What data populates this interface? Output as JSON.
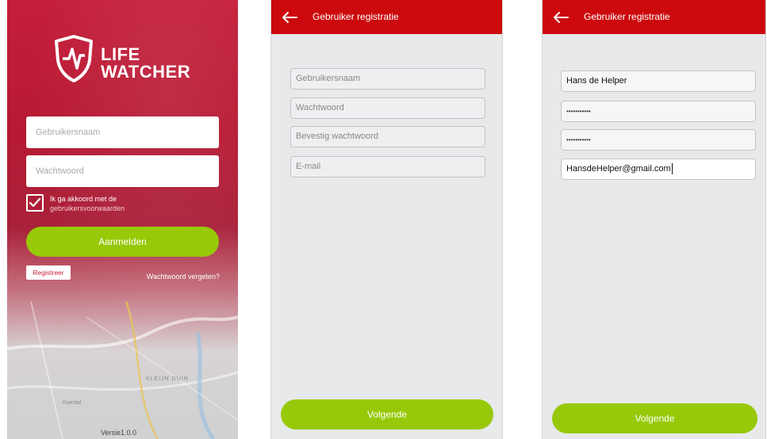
{
  "login": {
    "brand_line1": "LIFE",
    "brand_line2": "WATCHER",
    "username_placeholder": "Gebruikersnaam",
    "password_placeholder": "Wachtwoord",
    "terms_line1": "Ik ga akkoord met de",
    "terms_line2": "gebruikersvoorwaarden",
    "terms_checked": true,
    "login_button": "Aanmelden",
    "register_button": "Registreer",
    "forgot_link": "Wachtwoord vergeten?",
    "version": "Versie1.0.0",
    "map_labels": [
      "KLEIJN DUIN",
      "Koestal"
    ]
  },
  "registration_empty": {
    "title": "Gebruiker registratie",
    "fields": [
      {
        "placeholder": "Gebruikersnaam"
      },
      {
        "placeholder": "Wachtwoord"
      },
      {
        "placeholder": "Bevestig wachtwoord"
      },
      {
        "placeholder": "E-mail"
      }
    ],
    "next_button": "Volgende"
  },
  "registration_filled": {
    "title": "Gebruiker registratie",
    "username_value": "Hans de Helper",
    "password_masked": "•••••••••••",
    "confirm_masked": "•••••••••••",
    "email_value": "HansdeHelper@gmail.com",
    "next_button": "Volgende"
  },
  "colors": {
    "brand_red": "#cc0a0d",
    "login_red": "#c41e3a",
    "accent_green": "#97c909",
    "background_gray": "#e8e9ea"
  }
}
